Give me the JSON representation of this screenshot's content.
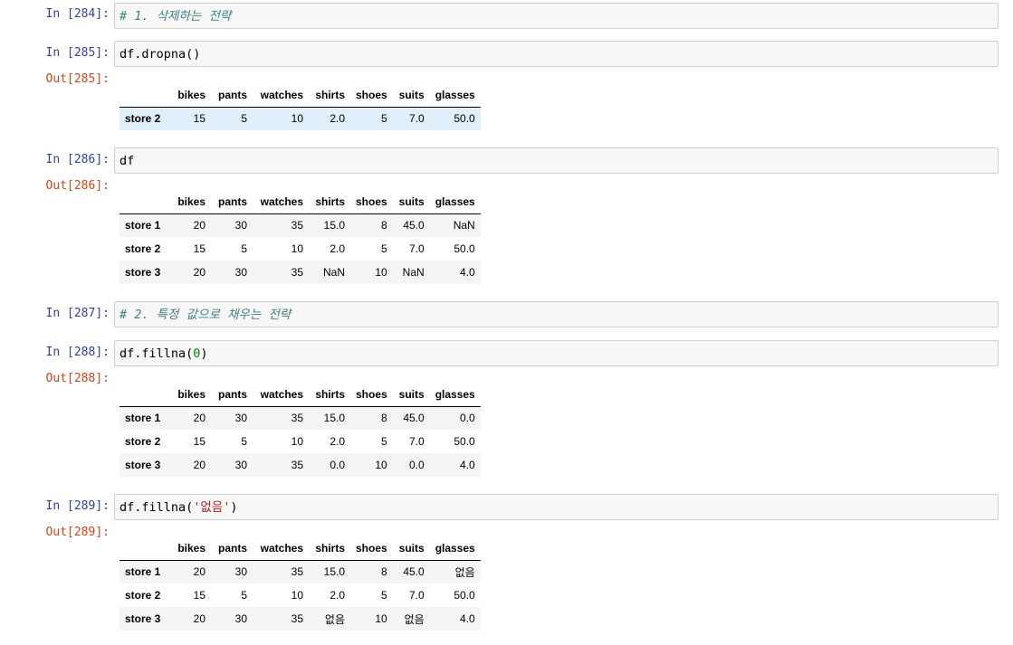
{
  "cells": [
    {
      "in": "In [284]:",
      "code": "# 1. 삭제하는 전략"
    },
    {
      "in": "In [285]:",
      "code": "df.dropna()",
      "out": "Out[285]:"
    },
    {
      "in": "In [286]:",
      "code": "df",
      "out": "Out[286]:"
    },
    {
      "in": "In [287]:",
      "code": "# 2. 특정 값으로 채우는 전략"
    },
    {
      "in": "In [288]:",
      "code_pre": "df.fillna(",
      "code_arg": "0",
      "code_post": ")",
      "out": "Out[288]:"
    },
    {
      "in": "In [289]:",
      "code_pre": "df.fillna(",
      "code_arg": "'없음'",
      "code_post": ")",
      "out": "Out[289]:"
    }
  ],
  "columns": [
    "",
    "bikes",
    "pants",
    "watches",
    "shirts",
    "shoes",
    "suits",
    "glasses"
  ],
  "tables": [
    {
      "rows": [
        [
          "store 2",
          "15",
          "5",
          "10",
          "2.0",
          "5",
          "7.0",
          "50.0"
        ]
      ]
    },
    {
      "rows": [
        [
          "store 1",
          "20",
          "30",
          "35",
          "15.0",
          "8",
          "45.0",
          "NaN"
        ],
        [
          "store 2",
          "15",
          "5",
          "10",
          "2.0",
          "5",
          "7.0",
          "50.0"
        ],
        [
          "store 3",
          "20",
          "30",
          "35",
          "NaN",
          "10",
          "NaN",
          "4.0"
        ]
      ]
    },
    {
      "rows": [
        [
          "store 1",
          "20",
          "30",
          "35",
          "15.0",
          "8",
          "45.0",
          "0.0"
        ],
        [
          "store 2",
          "15",
          "5",
          "10",
          "2.0",
          "5",
          "7.0",
          "50.0"
        ],
        [
          "store 3",
          "20",
          "30",
          "35",
          "0.0",
          "10",
          "0.0",
          "4.0"
        ]
      ]
    },
    {
      "rows": [
        [
          "store 1",
          "20",
          "30",
          "35",
          "15.0",
          "8",
          "45.0",
          "없음"
        ],
        [
          "store 2",
          "15",
          "5",
          "10",
          "2.0",
          "5",
          "7.0",
          "50.0"
        ],
        [
          "store 3",
          "20",
          "30",
          "35",
          "없음",
          "10",
          "없음",
          "4.0"
        ]
      ]
    }
  ],
  "colors": {
    "in_prompt": "#303f9f",
    "out_prompt": "#d84315",
    "input_bg": "#f7f7f7",
    "input_border": "#cfcfcf",
    "row_stripe": "#f5f5f5",
    "row_highlight": "#e1effa",
    "comment": "#408080",
    "number": "#008800",
    "string": "#ba2121"
  }
}
